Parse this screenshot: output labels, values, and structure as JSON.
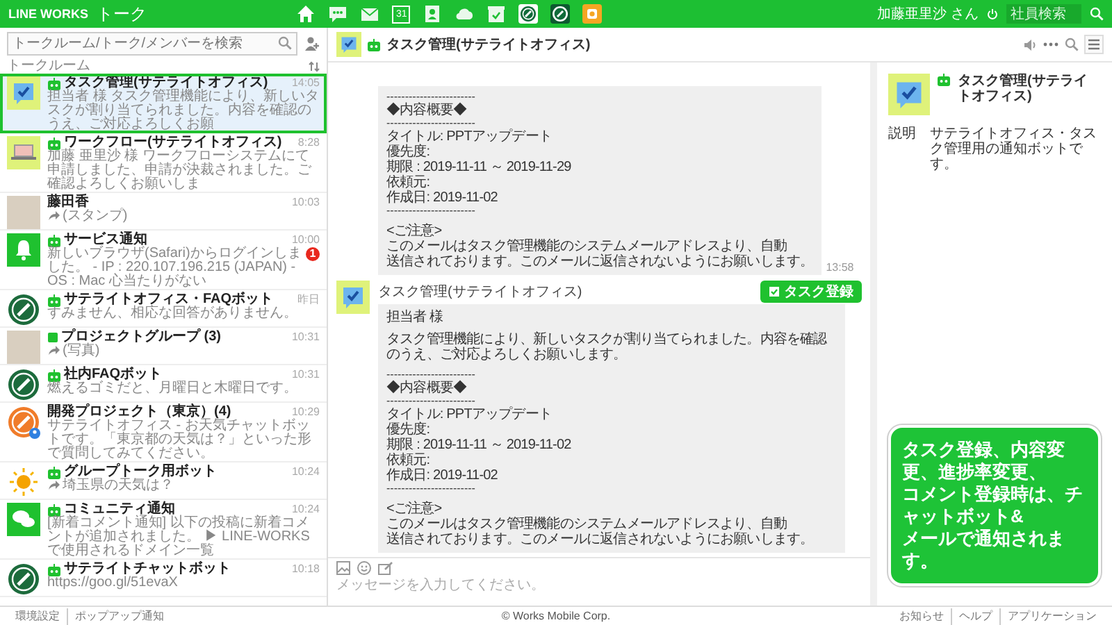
{
  "app": {
    "logo": "LINE WORKS",
    "title": "トーク"
  },
  "nav": [
    {
      "kind": "home"
    },
    {
      "kind": "chat"
    },
    {
      "kind": "mail"
    },
    {
      "kind": "calendar",
      "label": "31"
    },
    {
      "kind": "contacts"
    },
    {
      "kind": "cloud"
    },
    {
      "kind": "task"
    },
    {
      "kind": "app-light"
    },
    {
      "kind": "app-dark"
    },
    {
      "kind": "app-orange"
    }
  ],
  "user": {
    "name": "加藤亜里沙 さん"
  },
  "employee_search": {
    "placeholder": "社員検索"
  },
  "sidebar": {
    "search": {
      "placeholder": "トークルーム/トーク/メンバーを検索"
    },
    "section": "トークルーム",
    "rooms": [
      {
        "name": "タスク管理(サテライトオフィス)",
        "name_icon": {
          "kind": "bot"
        },
        "time": "14:05",
        "preview": "担当者 様 タスク管理機能により、新しいタスクが割り当てられました。内容を確認のうえ、ご対応よろしくお願",
        "forwarded": false,
        "avatar": {
          "kind": "task"
        },
        "selected": true
      },
      {
        "name": "ワークフロー(サテライトオフィス)",
        "name_icon": {
          "kind": "bot"
        },
        "time": "8:28",
        "preview": "加藤 亜里沙 様 ワークフローシステムにて申請しました、申請が決裁されました。ご確認よろしくお願いしま",
        "forwarded": false,
        "avatar": {
          "kind": "workflow"
        },
        "selected": false
      },
      {
        "name": "藤田香",
        "time": "10:03",
        "preview": "(スタンプ)",
        "forwarded": true,
        "avatar": {
          "kind": "photo"
        },
        "selected": false
      },
      {
        "name": "サービス通知",
        "name_icon": {
          "kind": "bot"
        },
        "time": "10:00",
        "preview": "新しいブラウザ(Safari)からログインしました。 - IP : 220.107.196.215 (JAPAN) - OS : Mac 心当たりがない",
        "forwarded": false,
        "avatar": {
          "kind": "bell"
        },
        "unread": "1",
        "selected": false
      },
      {
        "name": "サテライトオフィス・FAQボット",
        "name_icon": {
          "kind": "bot"
        },
        "time": "昨日",
        "preview": "すみません、相応な回答がありません。",
        "forwarded": false,
        "avatar": {
          "kind": "logo"
        },
        "selected": false
      },
      {
        "name": "プロジェクトグループ (3)",
        "name_icon": {
          "kind": "group"
        },
        "time": "10:31",
        "preview": "(写真)",
        "forwarded": true,
        "avatar": {
          "kind": "photo"
        },
        "selected": false
      },
      {
        "name": "社内FAQボット",
        "name_icon": {
          "kind": "bot"
        },
        "time": "10:31",
        "preview": "燃えるゴミだと、月曜日と木曜日です。",
        "forwarded": false,
        "avatar": {
          "kind": "logo"
        },
        "selected": false
      },
      {
        "name": "開発プロジェクト（東京）(4)",
        "time": "10:29",
        "preview": "サテライトオフィス - お天気チャットボットです。「東京都の天気は？」といった形で質問してみてください。",
        "forwarded": false,
        "avatar": {
          "kind": "logo-orange"
        },
        "selected": false
      },
      {
        "name": "グループトーク用ボット",
        "name_icon": {
          "kind": "bot"
        },
        "time": "10:24",
        "preview": "埼玉県の天気は？",
        "forwarded": true,
        "avatar": {
          "kind": "sun"
        },
        "selected": false
      },
      {
        "name": "コミュニティ通知",
        "name_icon": {
          "kind": "bot"
        },
        "time": "10:24",
        "preview": "[新着コメント通知] 以下の投稿に新着コメントが追加されました。 ▶ LINE-WORKSで使用されるドメイン一覧",
        "forwarded": false,
        "avatar": {
          "kind": "chat"
        },
        "selected": false
      },
      {
        "name": "サテライトチャットボット",
        "name_icon": {
          "kind": "bot"
        },
        "time": "10:18",
        "preview": "https://goo.gl/51evaX",
        "forwarded": false,
        "avatar": {
          "kind": "logo"
        },
        "selected": false
      }
    ]
  },
  "chat": {
    "title": "タスク管理(サテライトオフィス)",
    "title_icon": {
      "kind": "bot"
    },
    "avatar": {
      "kind": "task"
    },
    "messages": [
      {
        "time": "13:58",
        "paragraphs": [
          [
            {
              "kind": "rule",
              "text": "------------------------"
            },
            {
              "kind": "text",
              "text": "◆内容概要◆"
            },
            {
              "kind": "rule",
              "text": "------------------------"
            },
            {
              "kind": "text",
              "text": "タイトル: PPTアップデート"
            },
            {
              "kind": "text",
              "text": "優先度:"
            },
            {
              "kind": "text",
              "text": "期限 : 2019-11-11 ～ 2019-11-29"
            },
            {
              "kind": "text",
              "text": "依頼元:"
            },
            {
              "kind": "text",
              "text": "作成日: 2019-11-02"
            },
            {
              "kind": "rule",
              "text": "------------------------"
            }
          ],
          [
            {
              "kind": "text",
              "text": "<ご注意>"
            },
            {
              "kind": "text",
              "text": "このメールはタスク管理機能のシステムメールアドレスより、自動"
            },
            {
              "kind": "text",
              "text": "送信されております。このメールに返信されないようにお願いします。"
            }
          ]
        ]
      },
      {
        "sender": "タスク管理(サテライトオフィス)",
        "avatar": {
          "kind": "task"
        },
        "tag": {
          "label": "タスク登録"
        },
        "paragraphs": [
          [
            {
              "kind": "text",
              "text": "担当者 様"
            }
          ],
          [
            {
              "kind": "text",
              "text": "タスク管理機能により、新しいタスクが割り当てられました。内容を確認のうえ、ご対応よろしくお願いします。"
            }
          ],
          [
            {
              "kind": "rule",
              "text": "------------------------"
            },
            {
              "kind": "text",
              "text": "◆内容概要◆"
            },
            {
              "kind": "rule",
              "text": "------------------------"
            },
            {
              "kind": "text",
              "text": "タイトル: PPTアップデート"
            },
            {
              "kind": "text",
              "text": "優先度:"
            },
            {
              "kind": "text",
              "text": "期限 : 2019-11-11 ～ 2019-11-02"
            },
            {
              "kind": "text",
              "text": "依頼元:"
            },
            {
              "kind": "text",
              "text": "作成日: 2019-11-02"
            },
            {
              "kind": "rule",
              "text": "------------------------"
            }
          ],
          [
            {
              "kind": "text",
              "text": "<ご注意>"
            },
            {
              "kind": "text",
              "text": "このメールはタスク管理機能のシステムメールアドレスより、自動"
            },
            {
              "kind": "text",
              "text": "送信されております。このメールに返信されないようにお願いします。"
            }
          ]
        ]
      }
    ],
    "input": {
      "placeholder": "メッセージを入力してください。"
    }
  },
  "profile": {
    "title": "タスク管理(サテライトオフィス)",
    "title_icon": {
      "kind": "bot"
    },
    "avatar": {
      "kind": "task"
    },
    "fields": [
      {
        "label": "説明",
        "value": "サテライトオフィス・タスク管理用の通知ボットです。"
      }
    ]
  },
  "callout": {
    "lines": [
      "タスク登録、内容変更、進捗率変更、",
      "コメント登録時は、チャットボット&",
      "メールで通知されます。"
    ]
  },
  "footer": {
    "left": [
      "環境設定",
      "ポップアップ通知"
    ],
    "center": "© Works Mobile Corp.",
    "right": [
      "お知らせ",
      "ヘルプ",
      "アプリケーション"
    ]
  }
}
